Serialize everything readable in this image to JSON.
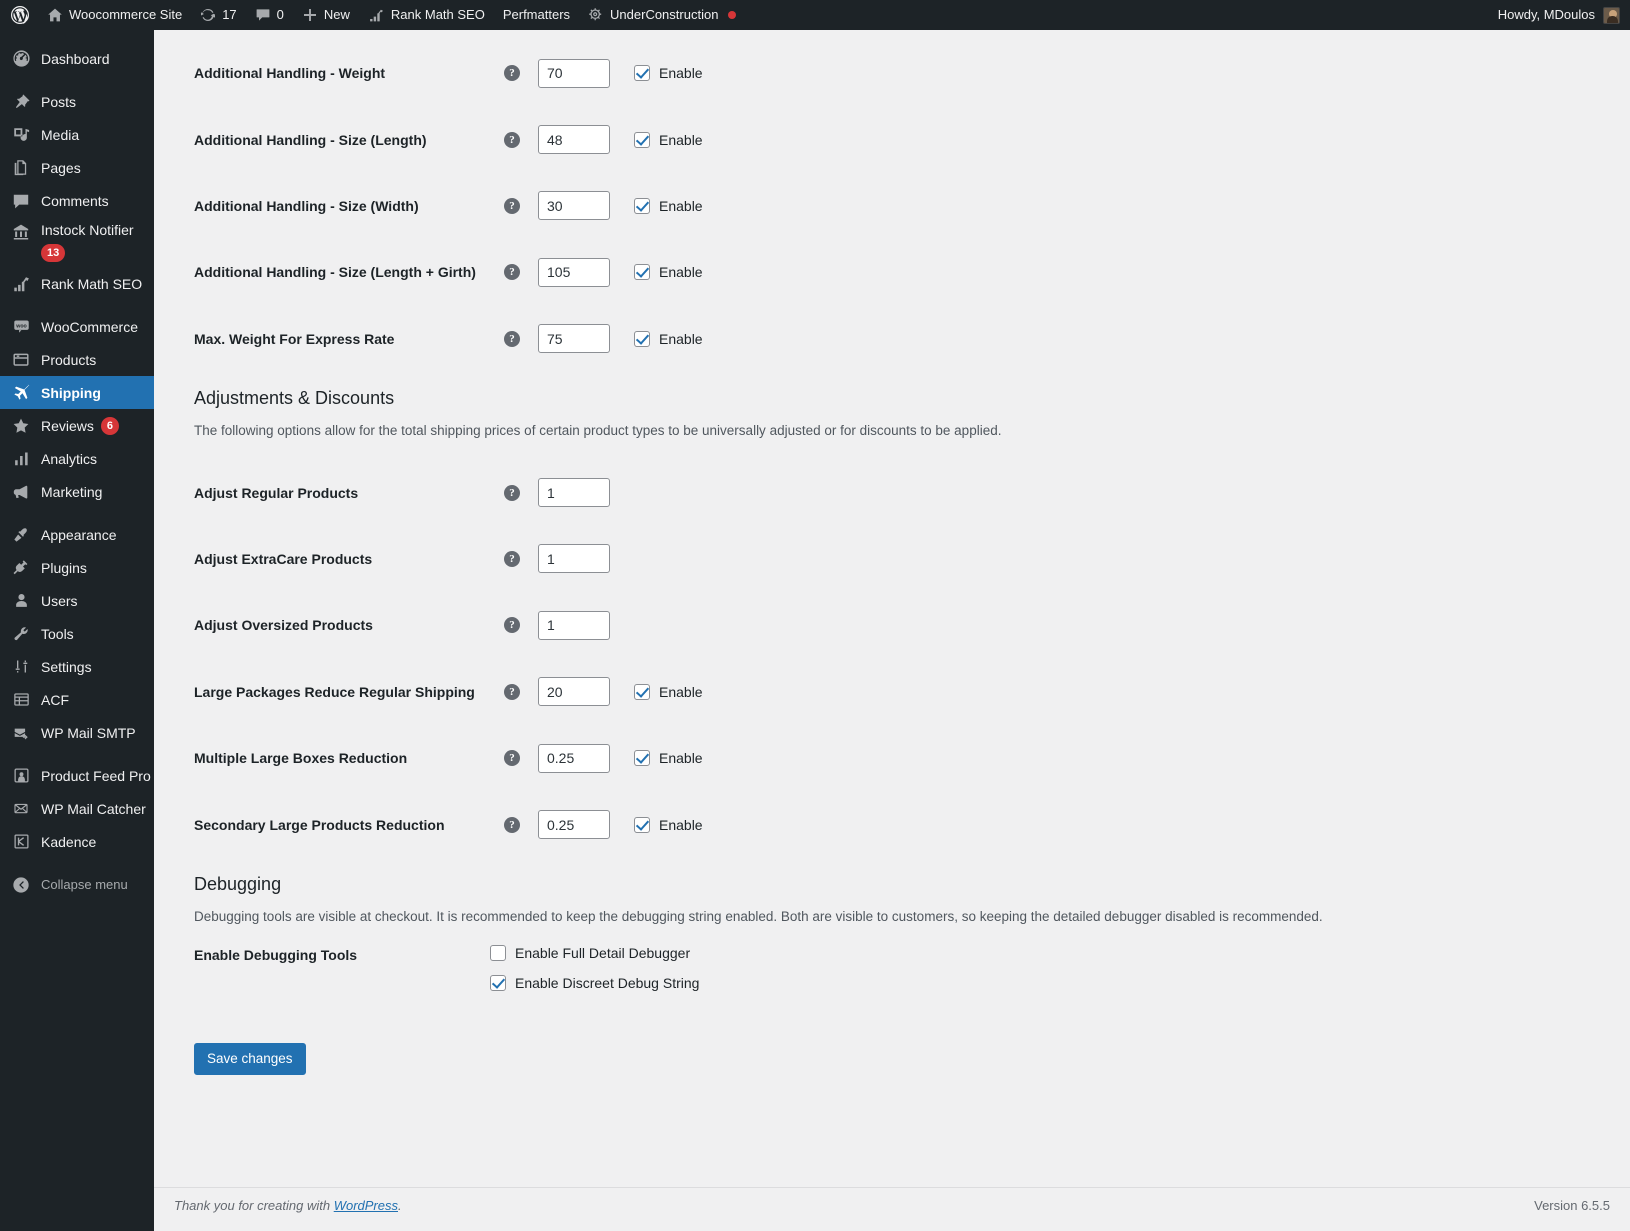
{
  "adminbar": {
    "site_name": "Woocommerce Site",
    "updates_count": "17",
    "comments_count": "0",
    "new_label": "New",
    "rank_math": "Rank Math SEO",
    "perfmatters": "Perfmatters",
    "underconstruction": "UnderConstruction",
    "howdy": "Howdy, MDoulos"
  },
  "sidebar": {
    "items": [
      {
        "label": "Dashboard",
        "icon": "dashboard-icon",
        "badge": "",
        "current": false,
        "sep_before": false
      },
      {
        "label": "Posts",
        "icon": "pin-icon",
        "badge": "",
        "current": false,
        "sep_before": true
      },
      {
        "label": "Media",
        "icon": "media-icon",
        "badge": "",
        "current": false,
        "sep_before": false
      },
      {
        "label": "Pages",
        "icon": "pages-icon",
        "badge": "",
        "current": false,
        "sep_before": false
      },
      {
        "label": "Comments",
        "icon": "comments-icon",
        "badge": "",
        "current": false,
        "sep_before": false
      },
      {
        "label": "Instock Notifier",
        "icon": "instock-icon",
        "badge": "13",
        "current": false,
        "sep_before": false
      },
      {
        "label": "Rank Math SEO",
        "icon": "rankmath-icon",
        "badge": "",
        "current": false,
        "sep_before": false
      },
      {
        "label": "WooCommerce",
        "icon": "woo-icon",
        "badge": "",
        "current": false,
        "sep_before": true
      },
      {
        "label": "Products",
        "icon": "products-icon",
        "badge": "",
        "current": false,
        "sep_before": false
      },
      {
        "label": "Shipping",
        "icon": "shipping-icon",
        "badge": "",
        "current": true,
        "sep_before": false
      },
      {
        "label": "Reviews",
        "icon": "star-icon",
        "badge": "6",
        "current": false,
        "sep_before": false
      },
      {
        "label": "Analytics",
        "icon": "analytics-icon",
        "badge": "",
        "current": false,
        "sep_before": false
      },
      {
        "label": "Marketing",
        "icon": "megaphone-icon",
        "badge": "",
        "current": false,
        "sep_before": false
      },
      {
        "label": "Appearance",
        "icon": "appearance-icon",
        "badge": "",
        "current": false,
        "sep_before": true
      },
      {
        "label": "Plugins",
        "icon": "plugins-icon",
        "badge": "",
        "current": false,
        "sep_before": false
      },
      {
        "label": "Users",
        "icon": "users-icon",
        "badge": "",
        "current": false,
        "sep_before": false
      },
      {
        "label": "Tools",
        "icon": "tools-icon",
        "badge": "",
        "current": false,
        "sep_before": false
      },
      {
        "label": "Settings",
        "icon": "settings-icon",
        "badge": "",
        "current": false,
        "sep_before": false
      },
      {
        "label": "ACF",
        "icon": "acf-icon",
        "badge": "",
        "current": false,
        "sep_before": false
      },
      {
        "label": "WP Mail SMTP",
        "icon": "mail-smtp-icon",
        "badge": "",
        "current": false,
        "sep_before": false
      },
      {
        "label": "Product Feed Pro",
        "icon": "product-feed-icon",
        "badge": "",
        "current": false,
        "sep_before": true
      },
      {
        "label": "WP Mail Catcher",
        "icon": "envelope-icon",
        "badge": "",
        "current": false,
        "sep_before": false
      },
      {
        "label": "Kadence",
        "icon": "kadence-icon",
        "badge": "",
        "current": false,
        "sep_before": false
      }
    ],
    "collapse_label": "Collapse menu"
  },
  "main": {
    "top_fields": [
      {
        "label": "Additional Handling - Weight",
        "value": "70",
        "has_enable": true,
        "enabled": true,
        "enable_label": "Enable"
      },
      {
        "label": "Additional Handling - Size (Length)",
        "value": "48",
        "has_enable": true,
        "enabled": true,
        "enable_label": "Enable"
      },
      {
        "label": "Additional Handling - Size (Width)",
        "value": "30",
        "has_enable": true,
        "enabled": true,
        "enable_label": "Enable"
      },
      {
        "label": "Additional Handling - Size (Length + Girth)",
        "value": "105",
        "has_enable": true,
        "enabled": true,
        "enable_label": "Enable"
      },
      {
        "label": "Max. Weight For Express Rate",
        "value": "75",
        "has_enable": true,
        "enabled": true,
        "enable_label": "Enable"
      }
    ],
    "adjustments": {
      "title": "Adjustments & Discounts",
      "description": "The following options allow for the total shipping prices of certain product types to be universally adjusted or for discounts to be applied.",
      "fields": [
        {
          "label": "Adjust Regular Products",
          "value": "1",
          "has_enable": false,
          "enabled": false,
          "enable_label": "Enable"
        },
        {
          "label": "Adjust ExtraCare Products",
          "value": "1",
          "has_enable": false,
          "enabled": false,
          "enable_label": "Enable"
        },
        {
          "label": "Adjust Oversized Products",
          "value": "1",
          "has_enable": false,
          "enabled": false,
          "enable_label": "Enable"
        },
        {
          "label": "Large Packages Reduce Regular Shipping",
          "value": "20",
          "has_enable": true,
          "enabled": true,
          "enable_label": "Enable"
        },
        {
          "label": "Multiple Large Boxes Reduction",
          "value": "0.25",
          "has_enable": true,
          "enabled": true,
          "enable_label": "Enable"
        },
        {
          "label": "Secondary Large Products Reduction",
          "value": "0.25",
          "has_enable": true,
          "enabled": true,
          "enable_label": "Enable"
        }
      ]
    },
    "debugging": {
      "title": "Debugging",
      "description": "Debugging tools are visible at checkout. It is recommended to keep the debugging string enabled. Both are visible to customers, so keeping the detailed debugger disabled is recommended.",
      "row_label": "Enable Debugging Tools",
      "options": [
        {
          "label": "Enable Full Detail Debugger",
          "checked": false
        },
        {
          "label": "Enable Discreet Debug String",
          "checked": true
        }
      ]
    },
    "save_label": "Save changes"
  },
  "footer": {
    "thanks_prefix": "Thank you for creating with ",
    "wordpress_link": "WordPress",
    "thanks_suffix": ".",
    "version": "Version 6.5.5"
  },
  "colors": {
    "accent": "#2271b1",
    "sidebar_bg": "#1d2327",
    "content_bg": "#f0f0f1",
    "badge_red": "#d63638"
  }
}
